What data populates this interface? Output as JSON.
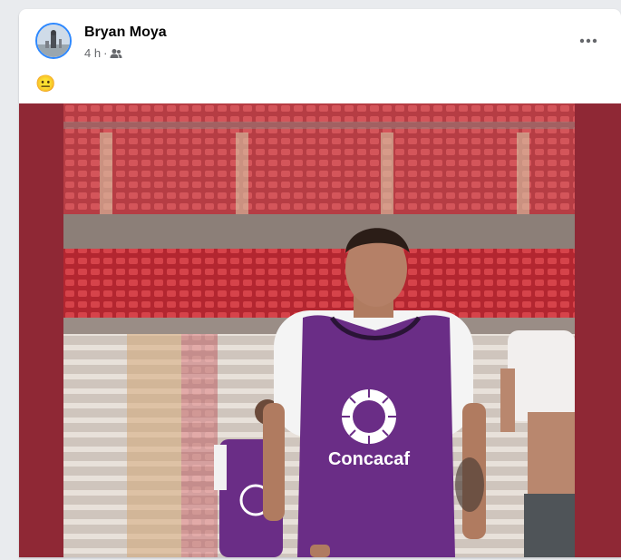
{
  "post": {
    "author": "Bryan Moya",
    "time": "4 h",
    "separator": "·",
    "audience_icon": "friends-icon",
    "text": "😐",
    "more_icon": "more-options-icon"
  },
  "photo": {
    "bib_text": "Concacaf"
  },
  "colors": {
    "media_background": "#8f2835",
    "bib": "#6a2d86",
    "seats": "#c0272f",
    "avatar_ring": "#2d88ff"
  }
}
